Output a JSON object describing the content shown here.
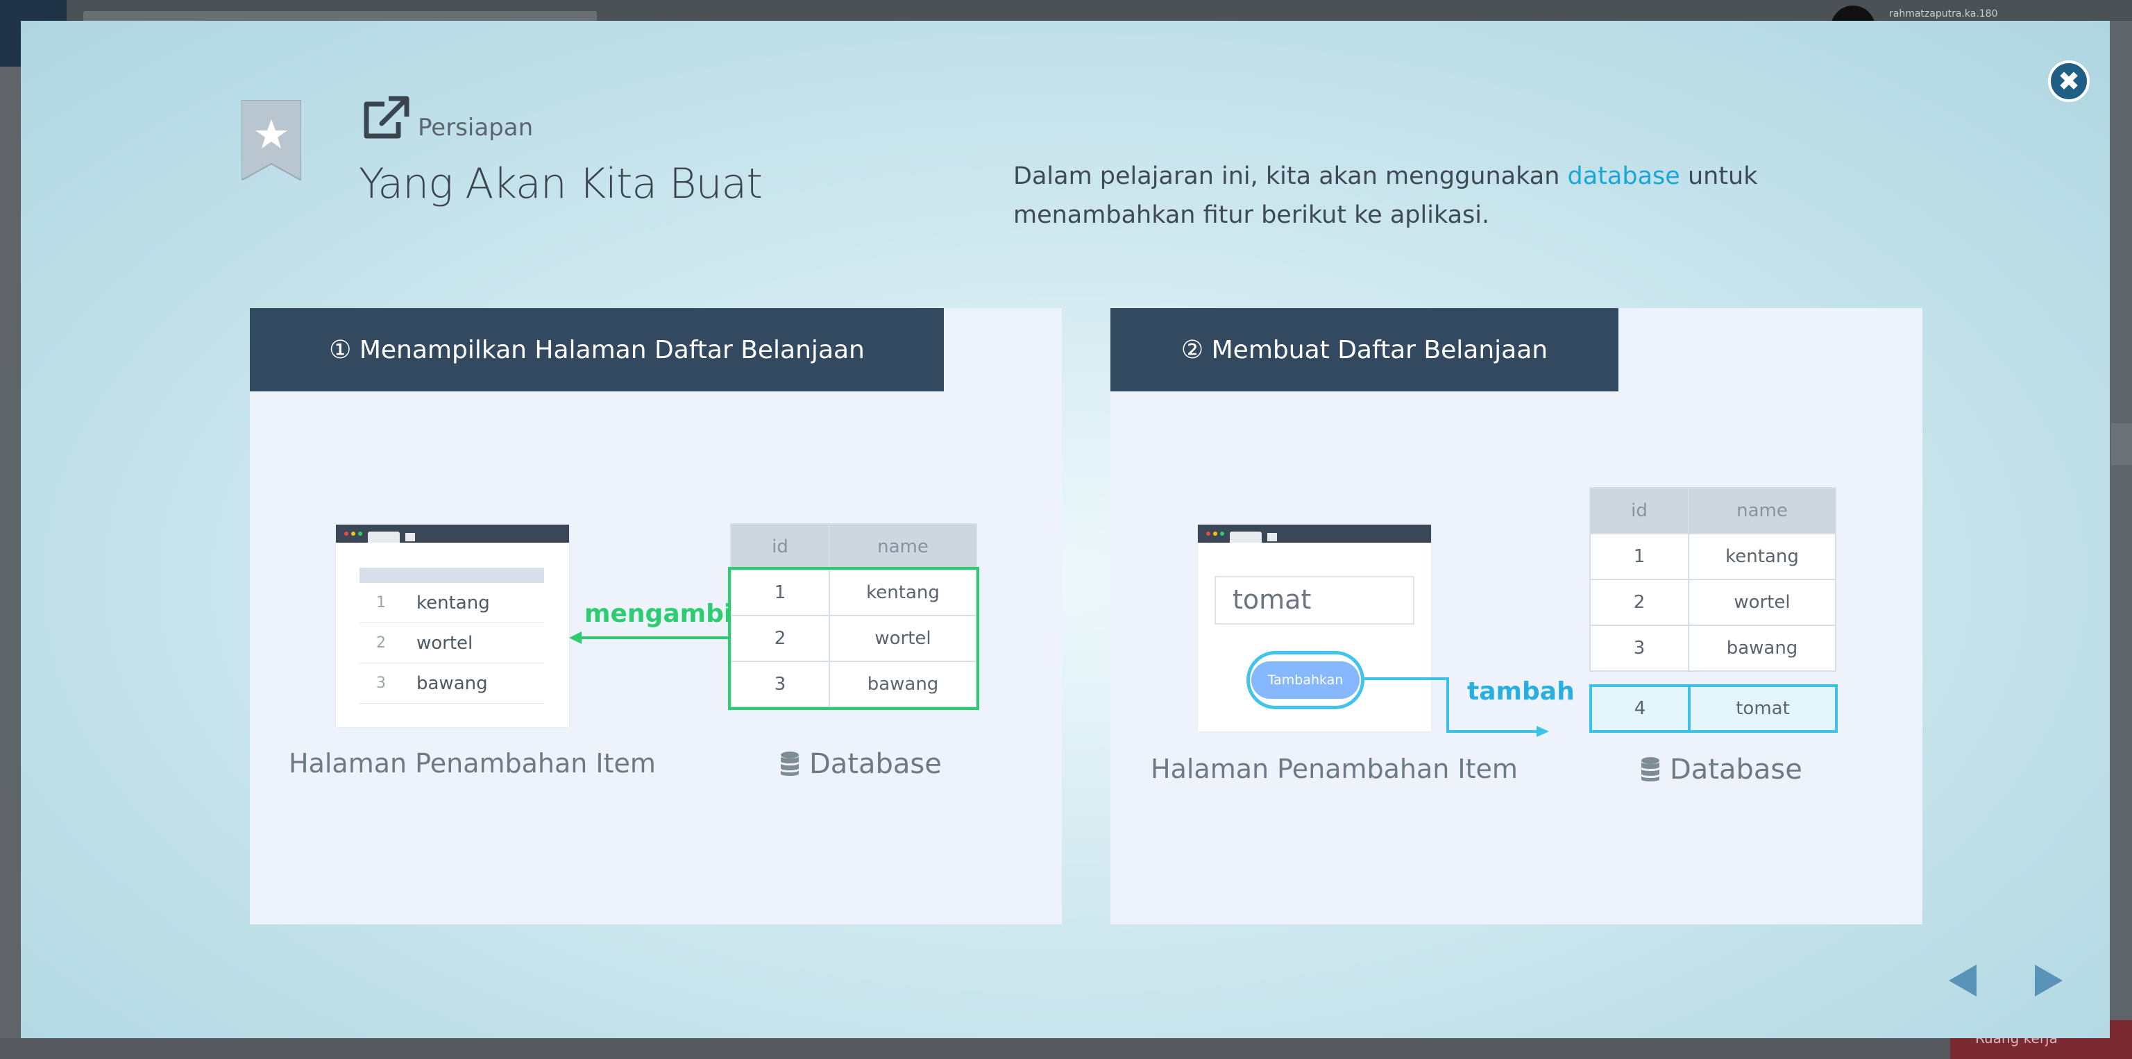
{
  "background": {
    "username": "rahmatzaputra.ka.180",
    "bottom_button": "Ruang kerja"
  },
  "modal": {
    "kicker": "Persiapan",
    "title": "Yang Akan Kita Buat",
    "intro_before": "Dalam pelajaran ini, kita akan menggunakan ",
    "intro_highlight": "database",
    "intro_after": " untuk menambahkan fitur berikut ke aplikasi.",
    "close_icon": "close-icon"
  },
  "panels": [
    {
      "heading": "① Menampilkan Halaman Daftar Belanjaan",
      "list": [
        {
          "num": "1",
          "name": "kentang"
        },
        {
          "num": "2",
          "name": "wortel"
        },
        {
          "num": "3",
          "name": "bawang"
        }
      ],
      "arrow_label": "mengambil",
      "table_headers": [
        "id",
        "name"
      ],
      "table_rows": [
        [
          "1",
          "kentang"
        ],
        [
          "2",
          "wortel"
        ],
        [
          "3",
          "bawang"
        ]
      ],
      "page_caption": "Halaman Penambahan Item",
      "db_caption": "Database"
    },
    {
      "heading": "② Membuat Daftar Belanjaan",
      "input_value": "tomat",
      "button_label": "Tambahkan",
      "arrow_label": "tambah",
      "table_headers": [
        "id",
        "name"
      ],
      "table_rows": [
        [
          "1",
          "kentang"
        ],
        [
          "2",
          "wortel"
        ],
        [
          "3",
          "bawang"
        ]
      ],
      "new_row": [
        "4",
        "tomat"
      ],
      "page_caption": "Halaman Penambahan Item",
      "db_caption": "Database"
    }
  ],
  "colors": {
    "accent": "#1aa6d6",
    "green": "#2ecc71",
    "panel_head": "#33495f"
  }
}
